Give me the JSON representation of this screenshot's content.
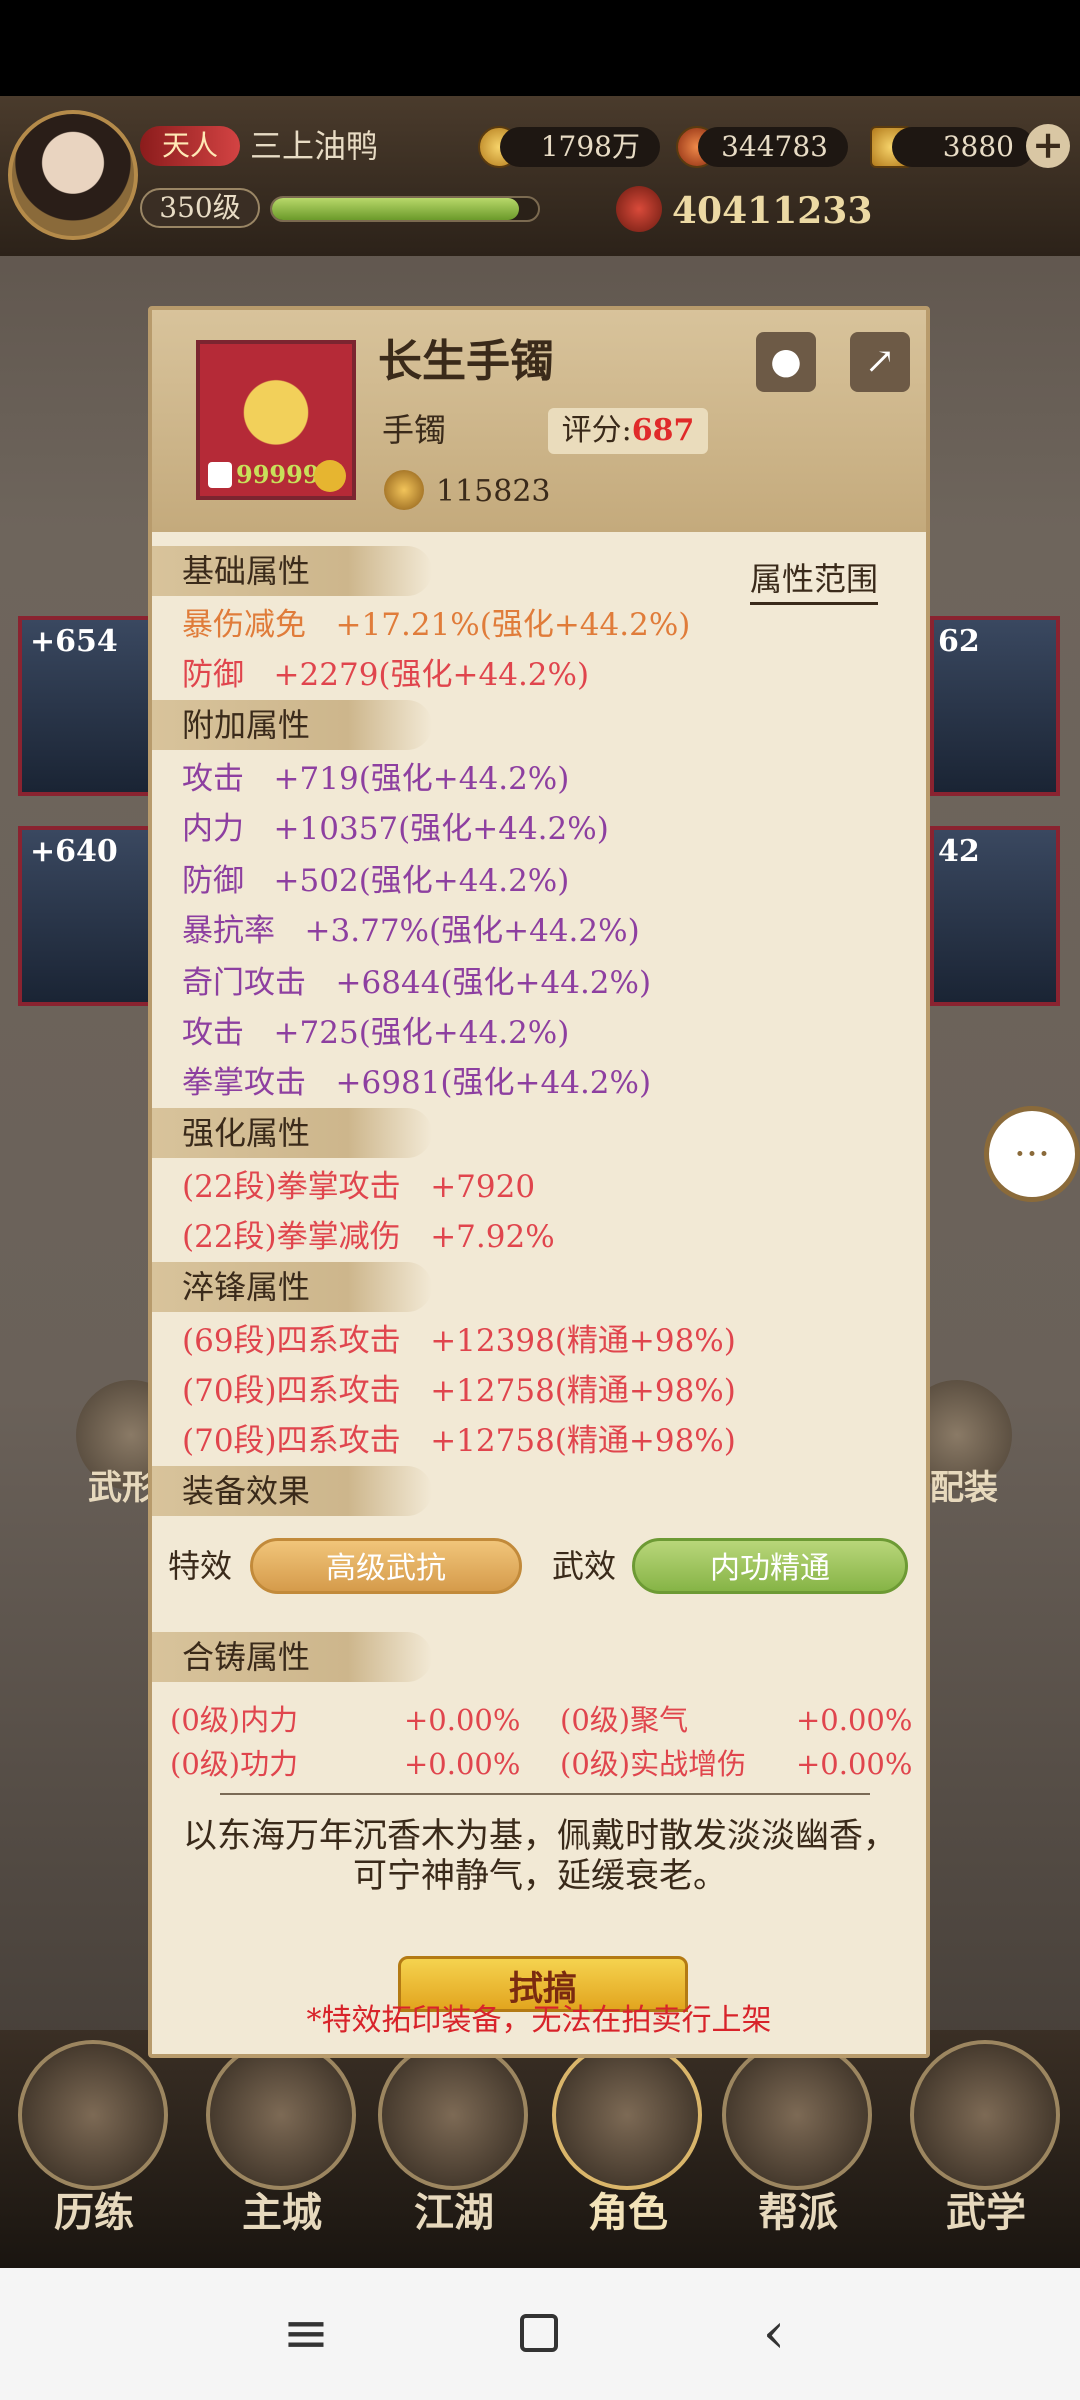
{
  "top_bar": {
    "vip_label": "天人",
    "player_name": "三上油鸭",
    "silver": "1798万",
    "gold_ingots": "344783",
    "yuanbao": "3880",
    "level": "350级",
    "exp_fraction": 0.93,
    "power": "40411233"
  },
  "item": {
    "name": "长生手镯",
    "type": "手镯",
    "score_label": "评分:",
    "score_value": "687",
    "icon_badge": "99999",
    "value": "115823"
  },
  "attr_range_link": "属性范围",
  "sections": {
    "basic": "基础属性",
    "extra": "附加属性",
    "enhance": "强化属性",
    "temper": "淬锋属性",
    "effect": "装备效果",
    "cast": "合铸属性"
  },
  "basic_attrs": [
    "暴伤减免   +17.21%(强化+44.2%)",
    "防御   +2279(强化+44.2%)"
  ],
  "extra_attrs": [
    "攻击   +719(强化+44.2%)",
    "内力   +10357(强化+44.2%)",
    "防御   +502(强化+44.2%)",
    "暴抗率   +3.77%(强化+44.2%)",
    "奇门攻击   +6844(强化+44.2%)",
    "攻击   +725(强化+44.2%)",
    "拳掌攻击   +6981(强化+44.2%)"
  ],
  "enhance_attrs": [
    "(22段)拳掌攻击   +7920",
    "(22段)拳掌减伤   +7.92%"
  ],
  "temper_attrs": [
    "(69段)四系攻击   +12398(精通+98%)",
    "(70段)四系攻击   +12758(精通+98%)",
    "(70段)四系攻击   +12758(精通+98%)"
  ],
  "effects": {
    "special_label": "特效",
    "special_value": "高级武抗",
    "martial_label": "武效",
    "martial_value": "内功精通"
  },
  "cast_attrs": [
    {
      "name": "(0级)内力",
      "value": "+0.00%"
    },
    {
      "name": "(0级)聚气",
      "value": "+0.00%"
    },
    {
      "name": "(0级)功力",
      "value": "+0.00%"
    },
    {
      "name": "(0级)实战增伤",
      "value": "+0.00%"
    }
  ],
  "description": "以东海万年沉香木为基，佩戴时散发淡淡幽香，可宁神静气，延缓衰老。",
  "inlay_button": "拭搞",
  "warning": "*特效拓印装备，无法在拍卖行上架",
  "side_badges": [
    "+654",
    "+640"
  ],
  "side_badges_right": [
    "62",
    "42"
  ],
  "bg_labels": [
    "武形",
    "配装"
  ],
  "bottom_nav": [
    "历练",
    "主城",
    "江湖",
    "角色",
    "帮派",
    "武学"
  ],
  "colors": {
    "orange_attr": "#e07c3a",
    "red_attr": "#e0454d",
    "purple_attr": "#8d3fa0",
    "score_red": "#e02a2a"
  }
}
